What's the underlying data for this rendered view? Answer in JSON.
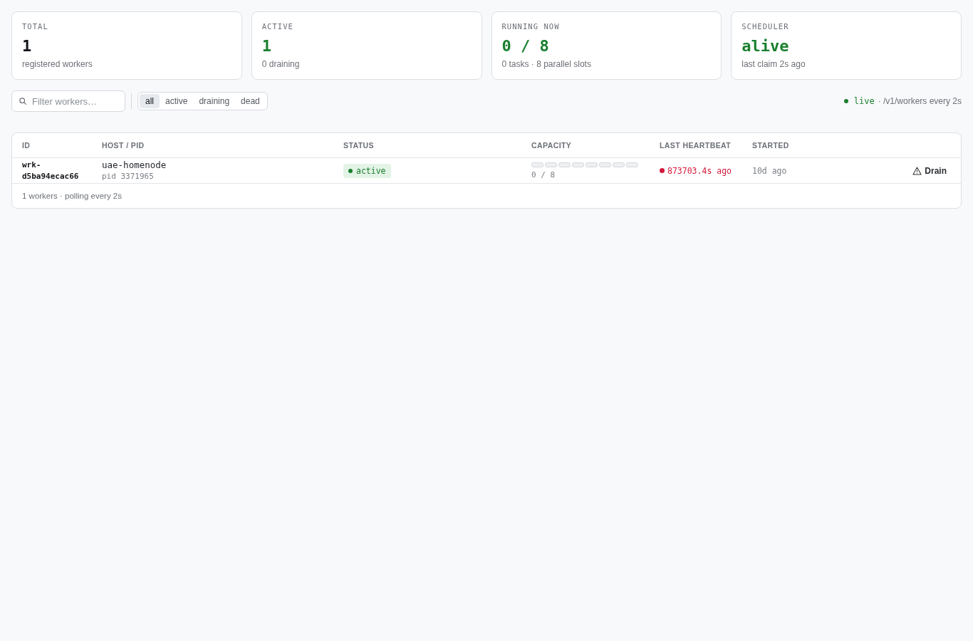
{
  "stats": [
    {
      "label": "TOTAL",
      "value": "1",
      "accent": false,
      "caption": "registered workers"
    },
    {
      "label": "ACTIVE",
      "value": "1",
      "accent": true,
      "caption": "0 draining"
    },
    {
      "label": "RUNNING NOW",
      "value": "0 / 8",
      "accent": true,
      "caption": "0 tasks · 8 parallel slots"
    },
    {
      "label": "SCHEDULER",
      "value": "alive",
      "accent": true,
      "caption": "last claim 2s ago"
    }
  ],
  "toolbar": {
    "search": {
      "placeholder": "Filter workers…"
    },
    "filters": [
      {
        "label": "all",
        "selected": true
      },
      {
        "label": "active",
        "selected": false
      },
      {
        "label": "draining",
        "selected": false
      },
      {
        "label": "dead",
        "selected": false
      }
    ],
    "live": {
      "on": true,
      "label": "live",
      "detail": "· /v1/workers every 2s"
    }
  },
  "table": {
    "columns": [
      "ID",
      "HOST / PID",
      "STATUS",
      "CAPACITY",
      "LAST HEARTBEAT",
      "STARTED"
    ],
    "rows": [
      {
        "id": "wrk-d5ba94ecac66",
        "host": "uae-homenode",
        "pid": "pid 3371965",
        "status": {
          "label": "active",
          "kind": "active"
        },
        "capacity": {
          "slots": [
            {
              "busy": false
            },
            {
              "busy": false
            },
            {
              "busy": false
            },
            {
              "busy": false
            },
            {
              "busy": false
            },
            {
              "busy": false
            },
            {
              "busy": false
            },
            {
              "busy": false
            }
          ],
          "reading": "0 / 8"
        },
        "last_heartbeat": {
          "text": "873703.4s ago",
          "stale": true
        },
        "started": "10d ago",
        "action": {
          "label": "Drain"
        }
      }
    ],
    "footer": "1 workers · polling every 2s"
  }
}
